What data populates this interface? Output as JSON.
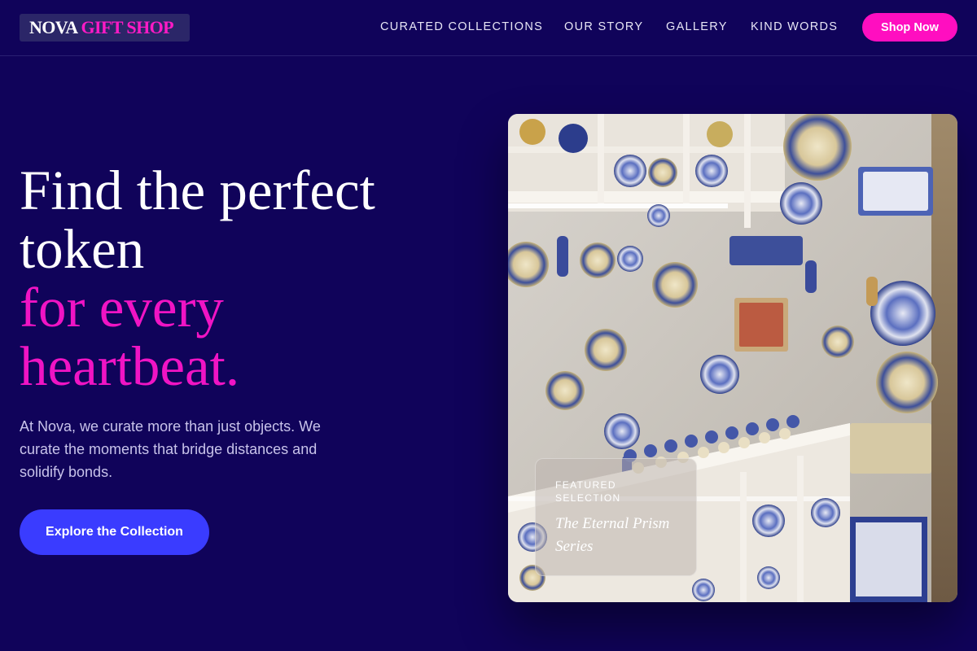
{
  "brand": {
    "part1": "NOVA",
    "part2": "GIFT SHOP"
  },
  "nav": {
    "items": [
      {
        "label": "CURATED COLLECTIONS"
      },
      {
        "label": "OUR STORY"
      },
      {
        "label": "GALLERY"
      },
      {
        "label": "KIND WORDS"
      }
    ],
    "cta_label": "Shop Now"
  },
  "hero": {
    "title_line1": "Find the perfect",
    "title_line2": "token",
    "title_line3": "for every",
    "title_line4": "heartbeat.",
    "description": "At Nova, we curate more than just objects. We curate the moments that bridge distances and solidify bonds.",
    "button_label": "Explore the Collection"
  },
  "featured": {
    "label_line1": "FEATURED",
    "label_line2": "SELECTION",
    "title": "The Eternal Prism Series"
  },
  "colors": {
    "background": "#10035a",
    "accent_pink": "#ff0ec0",
    "accent_blue": "#3a3cff"
  }
}
